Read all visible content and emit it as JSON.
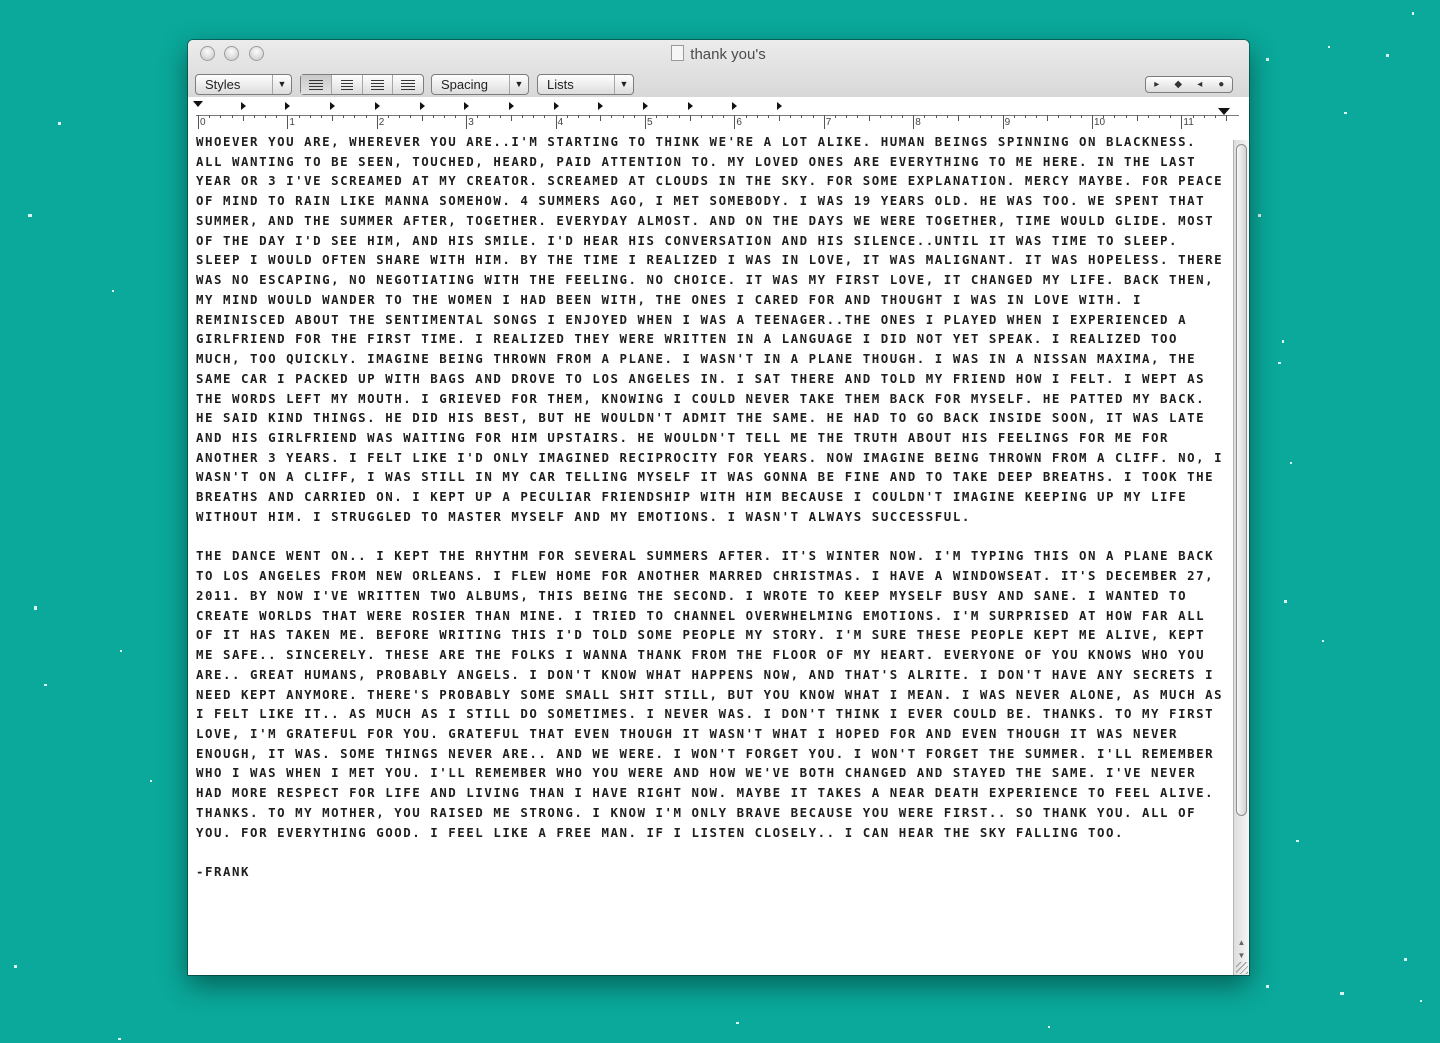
{
  "window": {
    "title": "thank you's"
  },
  "toolbar": {
    "styles_label": "Styles",
    "spacing_label": "Spacing",
    "lists_label": "Lists",
    "alignment_options": [
      "align-left",
      "align-center",
      "justify",
      "align-right"
    ],
    "selected_alignment": "align-left",
    "nav_icons": [
      "▸",
      "◆",
      "◂",
      "●"
    ]
  },
  "ruler": {
    "numbers": [
      "0",
      "1",
      "2",
      "3",
      "4",
      "5",
      "6",
      "7",
      "8",
      "9",
      "10",
      "11"
    ]
  },
  "document": {
    "paragraphs": [
      "WHOEVER YOU ARE, WHEREVER YOU ARE..I'M STARTING TO THINK WE'RE A LOT ALIKE. HUMAN BEINGS SPINNING ON BLACKNESS. ALL WANTING TO BE SEEN, TOUCHED, HEARD, PAID ATTENTION TO. MY LOVED ONES ARE EVERYTHING TO ME HERE. IN THE LAST YEAR OR 3 I'VE SCREAMED AT MY CREATOR. SCREAMED AT CLOUDS IN THE SKY. FOR SOME EXPLANATION. MERCY MAYBE. FOR PEACE OF MIND TO RAIN LIKE MANNA SOMEHOW. 4 SUMMERS AGO, I MET SOMEBODY. I WAS 19 YEARS OLD. HE WAS TOO. WE SPENT THAT SUMMER, AND THE SUMMER AFTER, TOGETHER. EVERYDAY ALMOST. AND ON THE DAYS WE WERE TOGETHER, TIME WOULD GLIDE. MOST OF THE DAY I'D SEE HIM, AND HIS SMILE. I'D HEAR HIS CONVERSATION AND HIS SILENCE..UNTIL IT WAS TIME TO SLEEP. SLEEP I WOULD OFTEN SHARE WITH HIM. BY THE TIME I REALIZED I WAS IN LOVE, IT WAS MALIGNANT. IT WAS HOPELESS. THERE WAS NO ESCAPING, NO NEGOTIATING WITH THE FEELING. NO CHOICE. IT WAS MY FIRST LOVE, IT CHANGED MY LIFE. BACK THEN, MY MIND WOULD WANDER TO THE WOMEN I HAD BEEN WITH, THE ONES I CARED FOR AND THOUGHT I WAS IN LOVE WITH. I REMINISCED ABOUT THE SENTIMENTAL SONGS I ENJOYED WHEN I WAS A TEENAGER..THE ONES I PLAYED WHEN I EXPERIENCED A GIRLFRIEND FOR THE FIRST TIME. I REALIZED THEY WERE WRITTEN IN A LANGUAGE I DID NOT YET SPEAK. I REALIZED TOO MUCH, TOO QUICKLY. IMAGINE BEING THROWN FROM A PLANE. I WASN'T IN A PLANE THOUGH. I WAS IN A NISSAN MAXIMA, THE SAME CAR I PACKED UP WITH BAGS AND DROVE TO LOS ANGELES IN. I SAT THERE AND TOLD MY FRIEND HOW I FELT. I WEPT AS THE WORDS LEFT MY MOUTH. I GRIEVED FOR THEM, KNOWING I COULD NEVER TAKE THEM BACK FOR MYSELF. HE PATTED MY BACK. HE SAID KIND THINGS. HE DID HIS BEST, BUT HE WOULDN'T ADMIT THE SAME. HE HAD TO GO BACK INSIDE SOON, IT WAS LATE AND HIS GIRLFRIEND WAS WAITING FOR HIM UPSTAIRS. HE WOULDN'T TELL ME THE TRUTH ABOUT HIS FEELINGS FOR ME FOR ANOTHER 3 YEARS. I FELT LIKE I'D ONLY IMAGINED RECIPROCITY FOR YEARS. NOW IMAGINE BEING THROWN FROM A CLIFF. NO, I WASN'T ON A CLIFF, I WAS STILL IN MY CAR TELLING MYSELF IT WAS GONNA BE FINE AND TO TAKE DEEP BREATHS. I TOOK THE BREATHS AND CARRIED ON. I KEPT UP A PECULIAR FRIENDSHIP WITH HIM BECAUSE I COULDN'T IMAGINE KEEPING UP MY LIFE WITHOUT HIM. I STRUGGLED TO MASTER MYSELF AND MY EMOTIONS. I WASN'T ALWAYS SUCCESSFUL.",
      "THE DANCE WENT ON.. I KEPT THE RHYTHM FOR SEVERAL SUMMERS AFTER. IT'S WINTER NOW. I'M TYPING THIS ON A PLANE BACK TO LOS ANGELES FROM NEW ORLEANS. I FLEW HOME FOR ANOTHER MARRED CHRISTMAS. I HAVE A WINDOWSEAT. IT'S DECEMBER 27, 2011. BY NOW I'VE WRITTEN TWO ALBUMS, THIS BEING THE SECOND. I WROTE TO KEEP MYSELF BUSY AND SANE. I WANTED TO CREATE WORLDS THAT WERE ROSIER THAN MINE. I TRIED TO CHANNEL OVERWHELMING EMOTIONS. I'M SURPRISED AT HOW FAR ALL OF IT HAS TAKEN ME. BEFORE WRITING THIS I'D TOLD SOME PEOPLE MY STORY. I'M SURE THESE PEOPLE KEPT ME ALIVE, KEPT ME SAFE.. SINCERELY. THESE ARE THE FOLKS I WANNA THANK FROM THE FLOOR OF MY HEART. EVERYONE OF YOU KNOWS WHO YOU ARE.. GREAT HUMANS, PROBABLY ANGELS. I DON'T KNOW WHAT HAPPENS NOW, AND THAT'S ALRITE. I DON'T HAVE ANY SECRETS I NEED KEPT ANYMORE. THERE'S PROBABLY SOME SMALL SHIT STILL, BUT YOU KNOW WHAT I MEAN. I WAS NEVER ALONE, AS MUCH AS I FELT LIKE IT.. AS MUCH AS I STILL DO SOMETIMES. I NEVER WAS. I DON'T THINK I EVER COULD BE. THANKS. TO MY FIRST LOVE, I'M GRATEFUL FOR YOU. GRATEFUL THAT EVEN THOUGH IT WASN'T WHAT I HOPED FOR AND EVEN THOUGH IT WAS NEVER ENOUGH, IT WAS. SOME THINGS NEVER ARE.. AND WE WERE. I WON'T FORGET YOU. I WON'T FORGET THE SUMMER. I'LL REMEMBER WHO I WAS WHEN I MET YOU. I'LL REMEMBER WHO YOU WERE AND HOW WE'VE BOTH CHANGED AND STAYED THE SAME. I'VE NEVER HAD MORE RESPECT FOR LIFE AND LIVING THAN I HAVE RIGHT NOW. MAYBE IT TAKES A NEAR DEATH EXPERIENCE TO FEEL ALIVE. THANKS. TO MY MOTHER, YOU RAISED ME STRONG. I KNOW I'M ONLY BRAVE BECAUSE YOU WERE FIRST.. SO THANK YOU. ALL OF YOU. FOR EVERYTHING GOOD. I FEEL LIKE A FREE MAN. IF I LISTEN CLOSELY.. I CAN HEAR THE SKY FALLING TOO.",
      "-FRANK"
    ]
  }
}
